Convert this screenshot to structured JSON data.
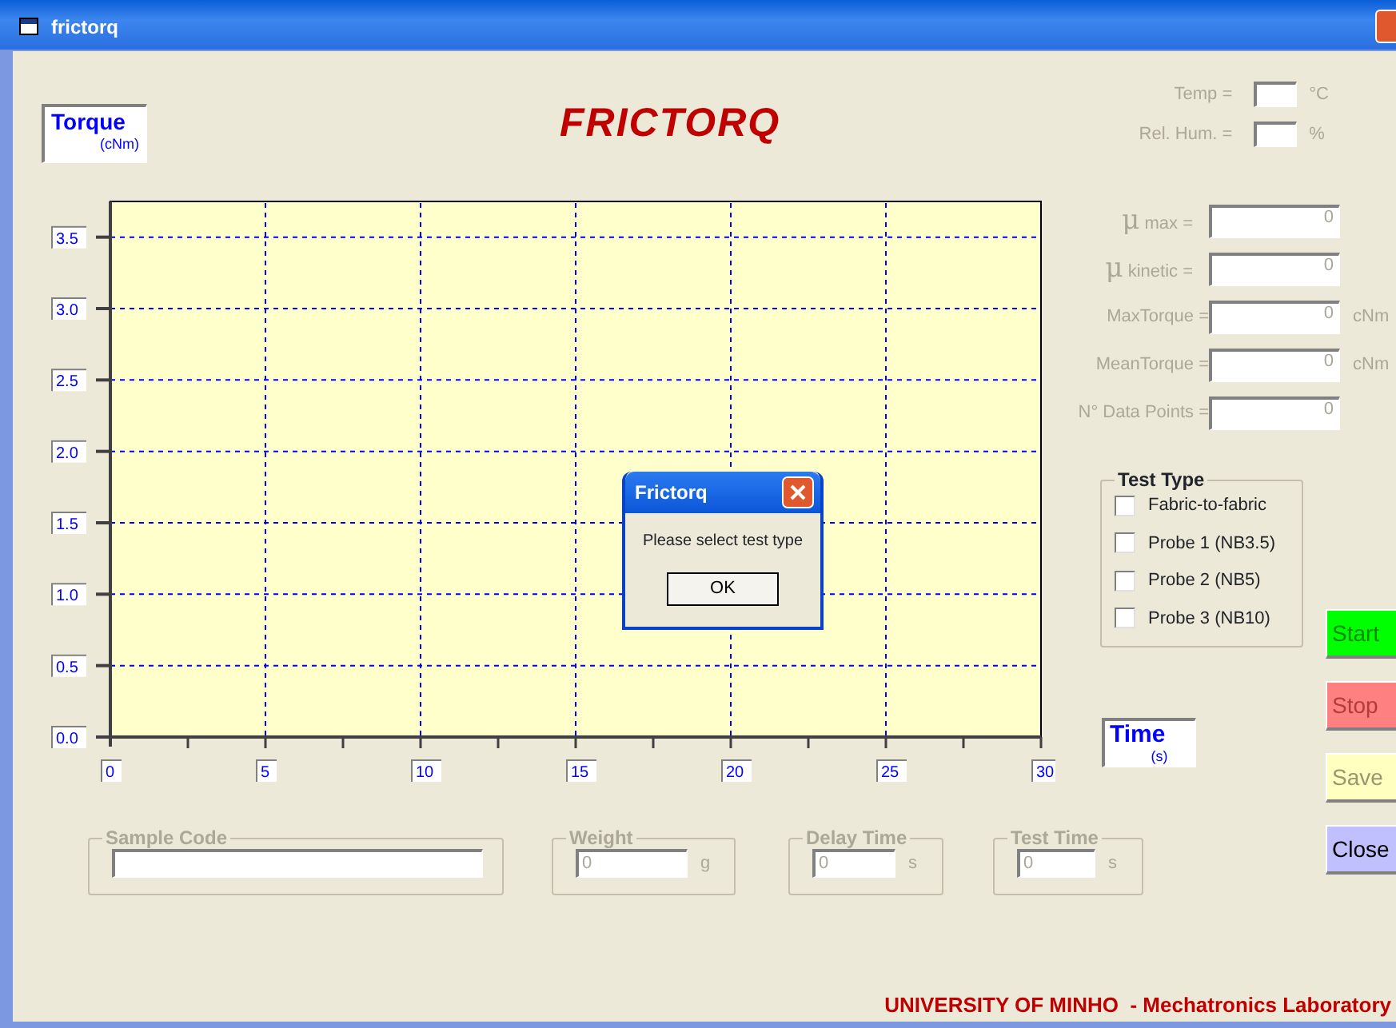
{
  "window": {
    "title": "frictorq"
  },
  "torque_label": {
    "text": "Torque",
    "unit": "(cNm)"
  },
  "app_title": "FRICTORQ",
  "environment": [
    {
      "label": "Temp =",
      "unit": "°C"
    },
    {
      "label": "Rel. Hum. =",
      "unit": "%"
    }
  ],
  "chart": {
    "chart_data": {
      "type": "line",
      "grid": true,
      "xlim": [
        0,
        30
      ],
      "ylim": [
        0,
        3.75
      ],
      "xticks": [
        0,
        5,
        10,
        15,
        20,
        25,
        30
      ],
      "yticks": [
        {
          "value": 0,
          "label": "0.0"
        },
        {
          "value": 0.5,
          "label": "0.5"
        },
        {
          "value": 1,
          "label": "1.0"
        },
        {
          "value": 1.5,
          "label": "1.5"
        },
        {
          "value": 2,
          "label": "2.0"
        },
        {
          "value": 2.5,
          "label": "2.5"
        },
        {
          "value": 3,
          "label": "3.0"
        },
        {
          "value": 3.5,
          "label": "3.5"
        }
      ]
    }
  },
  "results": [
    {
      "kind": "mu",
      "symbol": "μ",
      "label": "max =",
      "value": "0",
      "disabled": true
    },
    {
      "kind": "mu",
      "symbol": "μ",
      "label": "kinetic =",
      "value": "0",
      "disabled": true
    },
    {
      "kind": "plain",
      "label": "MaxTorque =",
      "value": "0",
      "unit": "cNm",
      "disabled": true
    },
    {
      "kind": "plain",
      "label": "MeanTorque =",
      "value": "0",
      "unit": "cNm",
      "disabled": true
    },
    {
      "kind": "plain",
      "label": "N° Data Points =",
      "value": "0",
      "disabled": true
    }
  ],
  "test_type": {
    "title": "Test Type",
    "options": [
      {
        "label": "Fabric-to-fabric",
        "checked": false
      },
      {
        "label": "Probe 1 (NB3.5)",
        "checked": false
      },
      {
        "label": "Probe 2 (NB5)",
        "checked": false
      },
      {
        "label": "Probe 3 (NB10)",
        "checked": false
      }
    ]
  },
  "time_label": {
    "text": "Time",
    "unit": "(s)"
  },
  "buttons": [
    {
      "label": "Start",
      "color": "#00ff00",
      "disabled": true
    },
    {
      "label": "Stop",
      "color": "#ff8080",
      "disabled": true
    },
    {
      "label": "Save",
      "color": "#ffffc0",
      "disabled": true
    },
    {
      "label": "Close",
      "color": "#c0c0ff",
      "disabled": false
    }
  ],
  "inputs": [
    {
      "kind": "wide",
      "label": "Sample Code",
      "disabled": true
    },
    {
      "kind": "short",
      "label": "Weight",
      "value": "0",
      "unit": "g",
      "disabled": true
    },
    {
      "kind": "short",
      "label": "Delay Time",
      "value": "0",
      "unit": "s",
      "disabled": true
    },
    {
      "kind": "short",
      "label": "Test Time",
      "value": "0",
      "unit": "s",
      "disabled": true
    }
  ],
  "footer": "UNIVERSITY OF MINHO  - Mechatronics Laboratory",
  "dialog": {
    "title": "Frictorq",
    "message": "Please select test type",
    "button": "OK"
  }
}
